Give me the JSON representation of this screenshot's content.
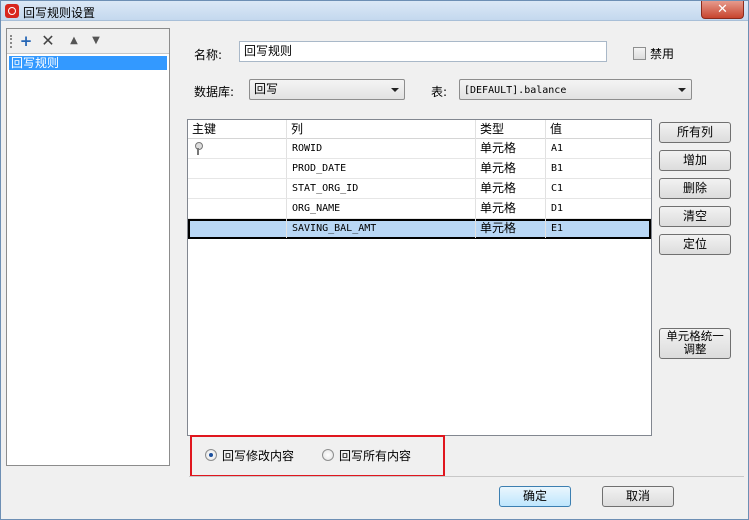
{
  "window": {
    "title": "回写规则设置",
    "close_glyph": "✕"
  },
  "toolbar": {
    "add_glyph": "+",
    "delete_glyph": "✕",
    "up_glyph": "▲",
    "down_glyph": "▼"
  },
  "rules": [
    {
      "label": "回写规则",
      "selected": true
    }
  ],
  "form": {
    "name_label": "名称:",
    "name_value": "回写规则",
    "disable_label": "禁用",
    "disable_checked": false,
    "database_label": "数据库:",
    "database_value": "回写",
    "table_label": "表:",
    "table_value": "[DEFAULT].balance"
  },
  "grid": {
    "columns": [
      "主键",
      "列",
      "类型",
      "值"
    ],
    "rows": [
      {
        "key": true,
        "column": "ROWID",
        "type": "单元格",
        "value": "A1"
      },
      {
        "key": false,
        "column": "PROD_DATE",
        "type": "单元格",
        "value": "B1"
      },
      {
        "key": false,
        "column": "STAT_ORG_ID",
        "type": "单元格",
        "value": "C1"
      },
      {
        "key": false,
        "column": "ORG_NAME",
        "type": "单元格",
        "value": "D1"
      },
      {
        "key": false,
        "column": "SAVING_BAL_AMT",
        "type": "单元格",
        "value": "E1"
      }
    ],
    "selected_row": 4
  },
  "side_buttons": {
    "all_columns": "所有列",
    "add": "增加",
    "delete": "删除",
    "clear": "清空",
    "locate": "定位",
    "unify_line1": "单元格统一",
    "unify_line2": "调整"
  },
  "writeback_mode": {
    "option_modified": "回写修改内容",
    "option_all": "回写所有内容",
    "selected": "option_modified"
  },
  "footer": {
    "ok": "确定",
    "cancel": "取消"
  },
  "colors": {
    "highlight_border": "#e0161e",
    "selection": "#3399ff",
    "row_selection": "#b9d7f5"
  }
}
